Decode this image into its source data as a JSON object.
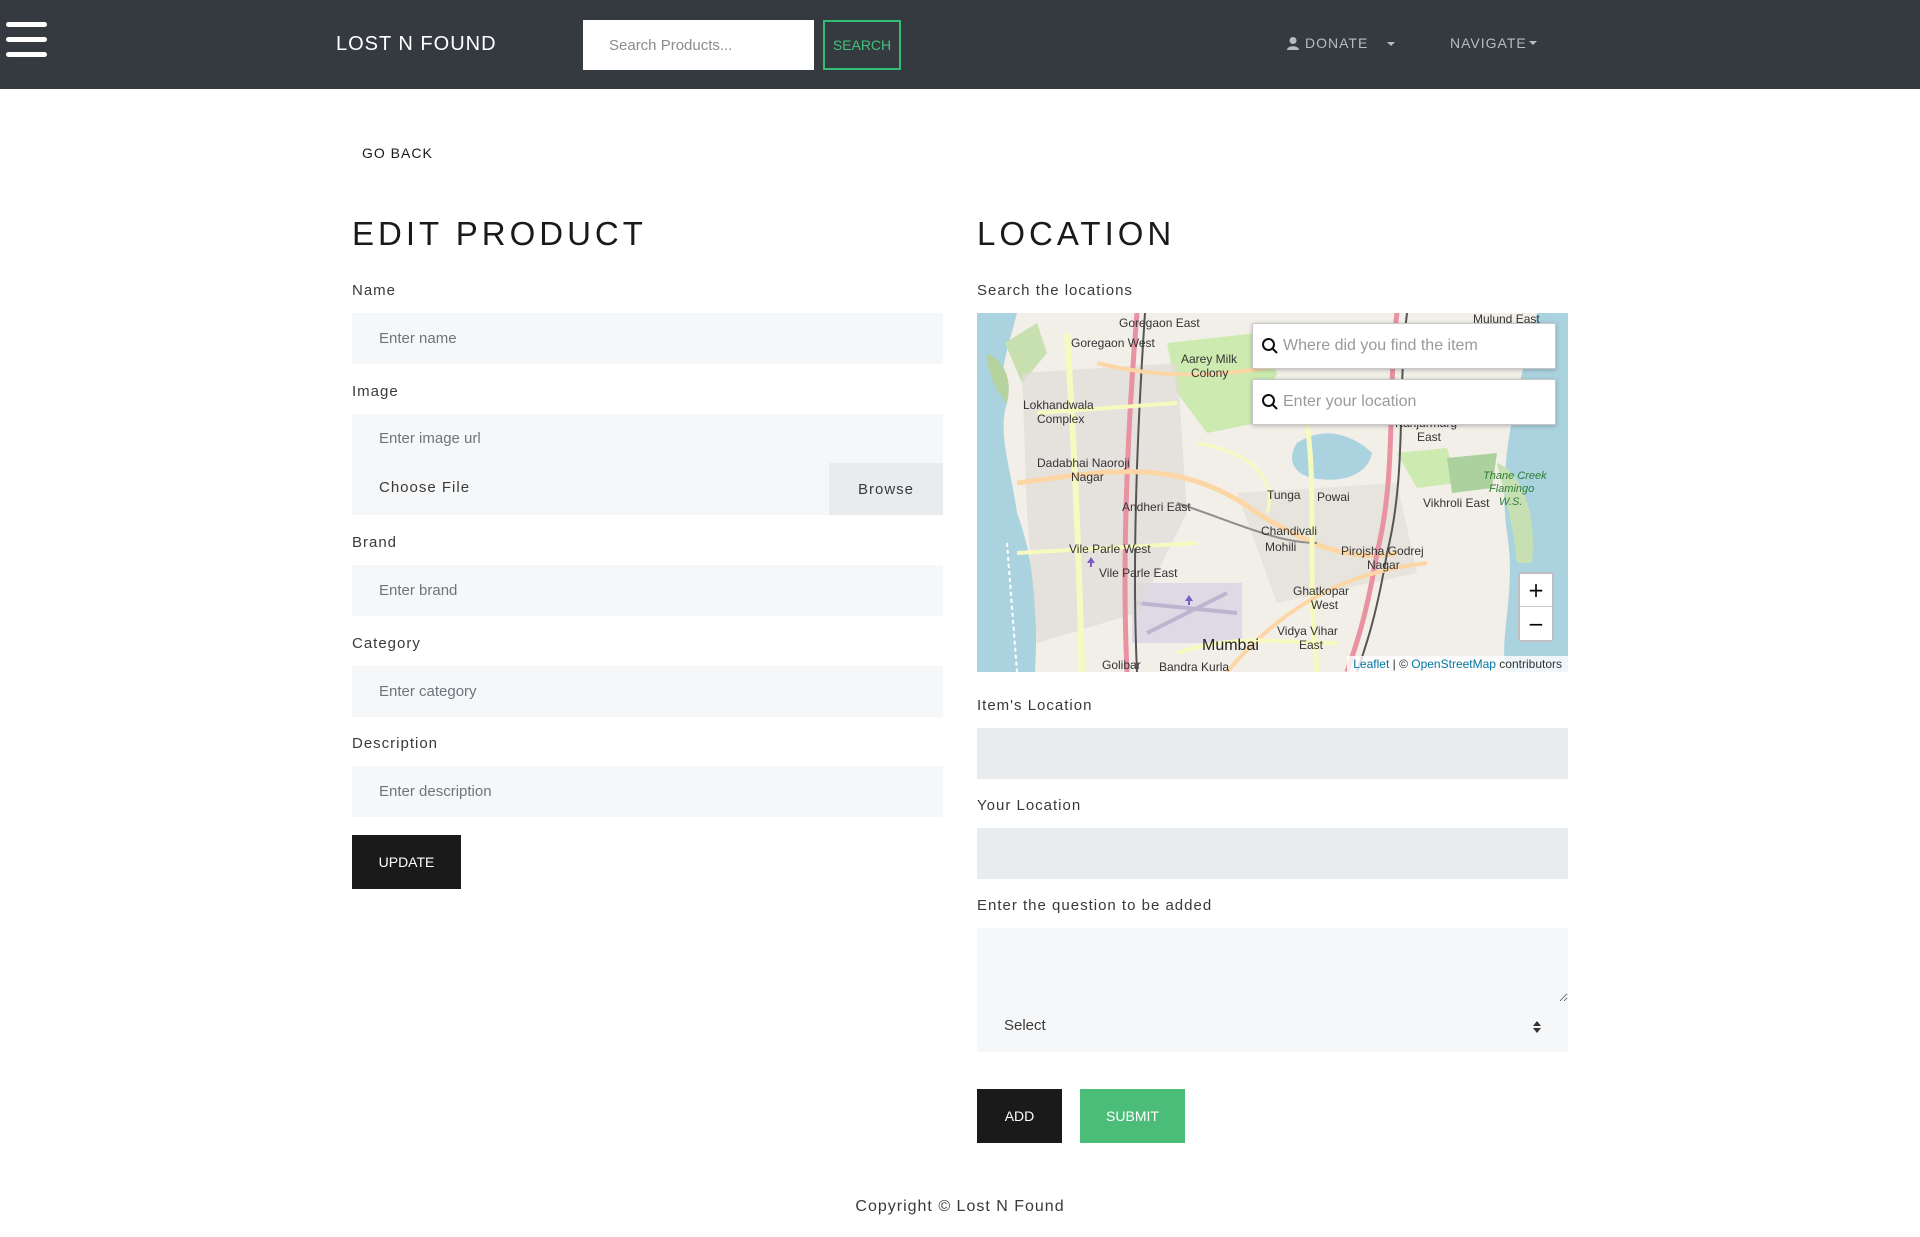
{
  "navbar": {
    "brand": "LOST N FOUND",
    "search_placeholder": "Search Products...",
    "search_button": "SEARCH",
    "donate_label": "DONATE",
    "navigate_label": "NAVIGATE"
  },
  "go_back": "GO BACK",
  "edit_product": {
    "title": "EDIT PRODUCT",
    "name_label": "Name",
    "name_placeholder": "Enter name",
    "image_label": "Image",
    "image_placeholder": "Enter image url",
    "choose_file": "Choose File",
    "browse": "Browse",
    "brand_label": "Brand",
    "brand_placeholder": "Enter brand",
    "category_label": "Category",
    "category_placeholder": "Enter category",
    "description_label": "Description",
    "description_placeholder": "Enter description",
    "update_button": "UPDATE"
  },
  "location": {
    "title": "LOCATION",
    "search_label": "Search the locations",
    "map_search_item_placeholder": "Where did you find the item",
    "map_search_user_placeholder": "Enter your location",
    "zoom_in": "+",
    "zoom_out": "−",
    "attribution_leaflet": "Leaflet",
    "attribution_sep": " | © ",
    "attribution_osm": "OpenStreetMap",
    "attribution_contrib": " contributors",
    "map_labels": {
      "goregaon_east": "Goregaon East",
      "goregaon_west": "Goregaon West",
      "aarey": "Aarey Milk",
      "colony": "Colony",
      "lokhandwala": "Lokhandwala",
      "complex": "Complex",
      "dadabhai": "Dadabhai Naoroji",
      "nagar": "Nagar",
      "andheri_east": "Andheri East",
      "vile_parle_west": "Vile Parle West",
      "vile_parle_east": "Vile Parle East",
      "tunga": "Tunga",
      "powai": "Powai",
      "chandivali": "Chandivali",
      "mohili": "Mohili",
      "vikhroli_east": "Vikhroli East",
      "pirojsha": "Pirojsha Godrej",
      "pirojsha_nagar": "Nagar",
      "ghatkopar": "Ghatkopar",
      "ghatkopar_west": "West",
      "vidya_vihar": "Vidya Vihar",
      "vidya_east": "East",
      "mumbai": "Mumbai",
      "golibar": "Golibar",
      "bandra_kurla": "Bandra Kurla",
      "mulund_east": "Mulund East",
      "kanjurmarg": "Kanjurmarg",
      "kanjur_east": "East",
      "thane_creek": "Thane Creek",
      "flamingo": "Flamingo",
      "ws": "W.S."
    },
    "items_location_label": "Item's Location",
    "your_location_label": "Your Location",
    "question_label": "Enter the question to be added",
    "select_label": "Select",
    "add_button": "ADD",
    "submit_button": "SUBMIT"
  },
  "footer": "Copyright © Lost N Found"
}
